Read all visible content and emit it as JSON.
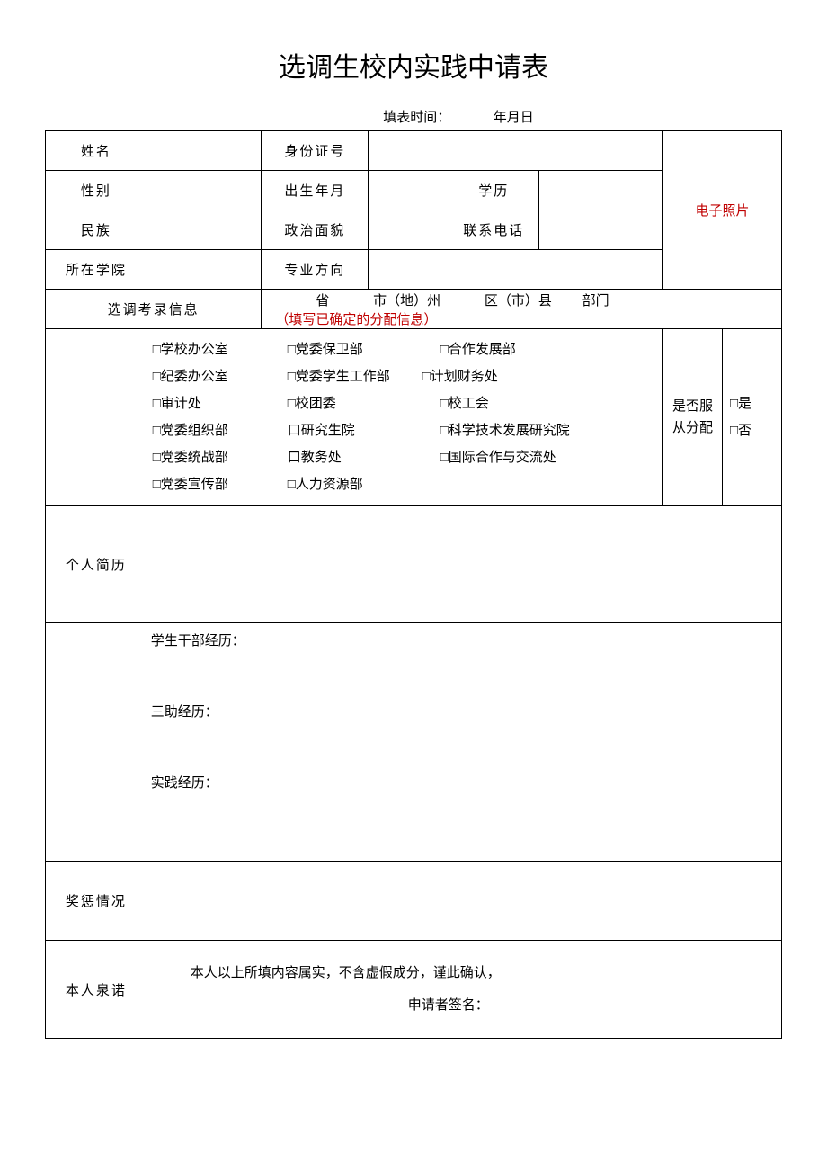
{
  "title": "选调生校内实践中请表",
  "fillTime": {
    "label": "填表时间：",
    "dateFormat": "年月日"
  },
  "labels": {
    "name": "姓名",
    "idNumber": "身份证号",
    "gender": "性别",
    "birthDate": "出生年月",
    "education": "学历",
    "ethnicity": "民族",
    "political": "政治面貌",
    "phone": "联系电话",
    "college": "所在学院",
    "major": "专业方向",
    "photo": "电子照片",
    "examInfo": "选调考录信息",
    "resume": "个人简历",
    "awards": "奖惩情况",
    "promise": "本人泉诺",
    "obeyAssign": "是否服从分配",
    "yes": "□是",
    "no": "□否"
  },
  "examLocation": {
    "province": "省",
    "city": "市（地）州",
    "district": "区（市）县",
    "dept": "部门",
    "hint": "（填写已确定的分配信息）"
  },
  "departments": {
    "col1": [
      "□学校办公室",
      "□纪委办公室",
      "□审计处",
      "□党委组织部",
      "□党委统战部",
      "□党委宣传部"
    ],
    "col2": [
      "□党委保卫部",
      "□党委学生工作部",
      "□校团委",
      "口研究生院",
      "口教务处",
      "□人力资源部"
    ],
    "col3": [
      "□合作发展部",
      "□计划财务处",
      "□校工会",
      "□科学技术发展研究院",
      "□国际合作与交流处",
      ""
    ]
  },
  "experience": {
    "cadre": "学生干部经历：",
    "sanzhu": "三助经历：",
    "practice": "实践经历："
  },
  "confirmation": {
    "line1": "本人以上所填内容属实，不含虚假成分，谨此确认，",
    "line2": "申请者签名："
  }
}
